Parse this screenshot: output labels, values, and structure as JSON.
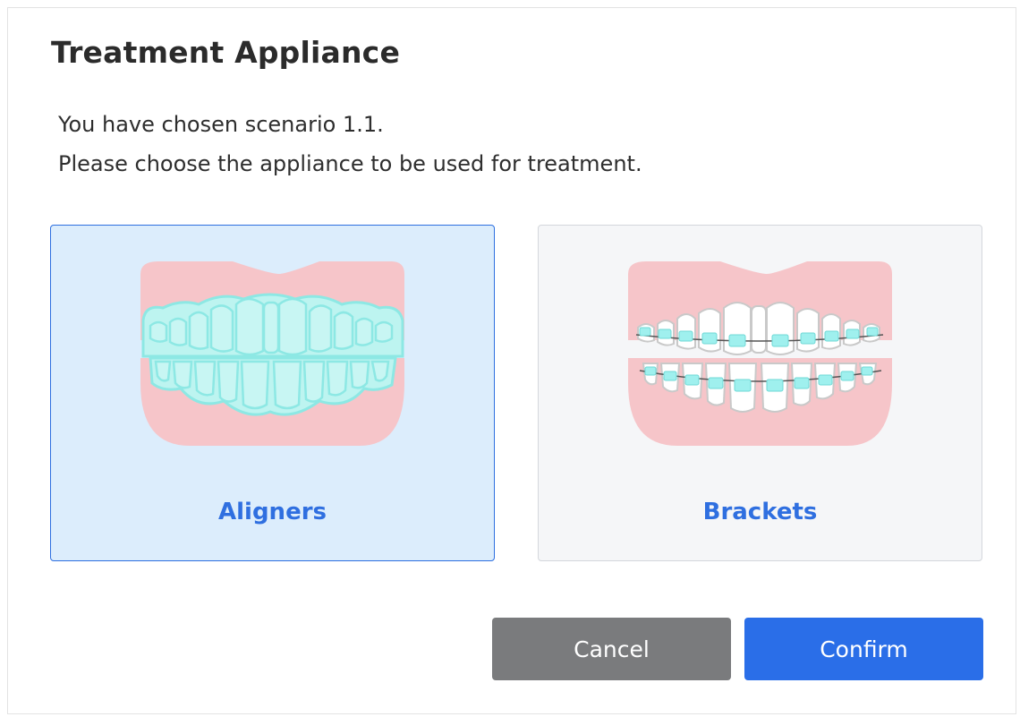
{
  "dialog": {
    "title": "Treatment Appliance",
    "description_line1": "You have chosen scenario 1.1.",
    "description_line2": "Please choose the appliance to be used for treatment."
  },
  "options": [
    {
      "label": "Aligners",
      "selected": true,
      "icon": "teeth-aligners-icon"
    },
    {
      "label": "Brackets",
      "selected": false,
      "icon": "teeth-brackets-icon"
    }
  ],
  "buttons": {
    "cancel_label": "Cancel",
    "confirm_label": "Confirm"
  },
  "colors": {
    "accent": "#2a6ee8",
    "selected_bg": "#dcedfc",
    "gum": "#f6c5c9",
    "aligner": "#c8f6f3",
    "bracket": "#9ff0ee",
    "cancel_bg": "#7a7b7d"
  }
}
